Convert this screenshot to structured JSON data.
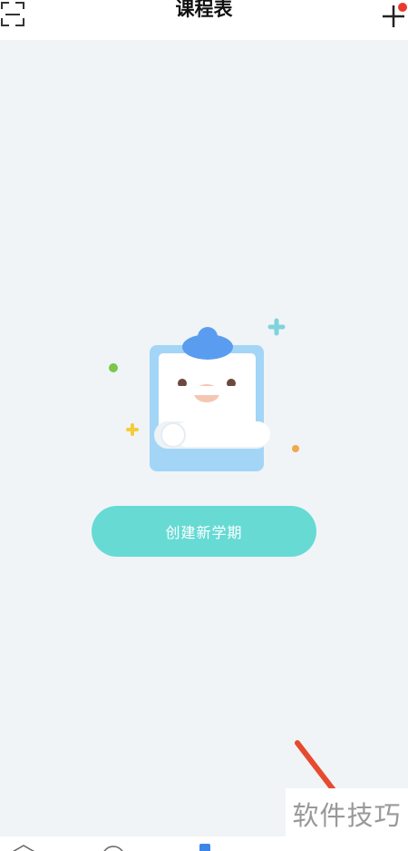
{
  "header": {
    "title": "课程表",
    "left_icon": "scan-icon",
    "right_icon": "plus-icon",
    "notification_dot_color": "#e83a2f"
  },
  "empty_state": {
    "illustration": "clipboard-mascot",
    "button_label": "创建新学期",
    "button_color": "#67dad4"
  },
  "annotation": {
    "arrow_color": "#e84a2f"
  },
  "watermark": {
    "text": "软件技巧"
  },
  "tabbar": {
    "icons": [
      "home-icon",
      "discover-icon",
      "schedule-icon"
    ],
    "active_color": "#3d86e8"
  }
}
